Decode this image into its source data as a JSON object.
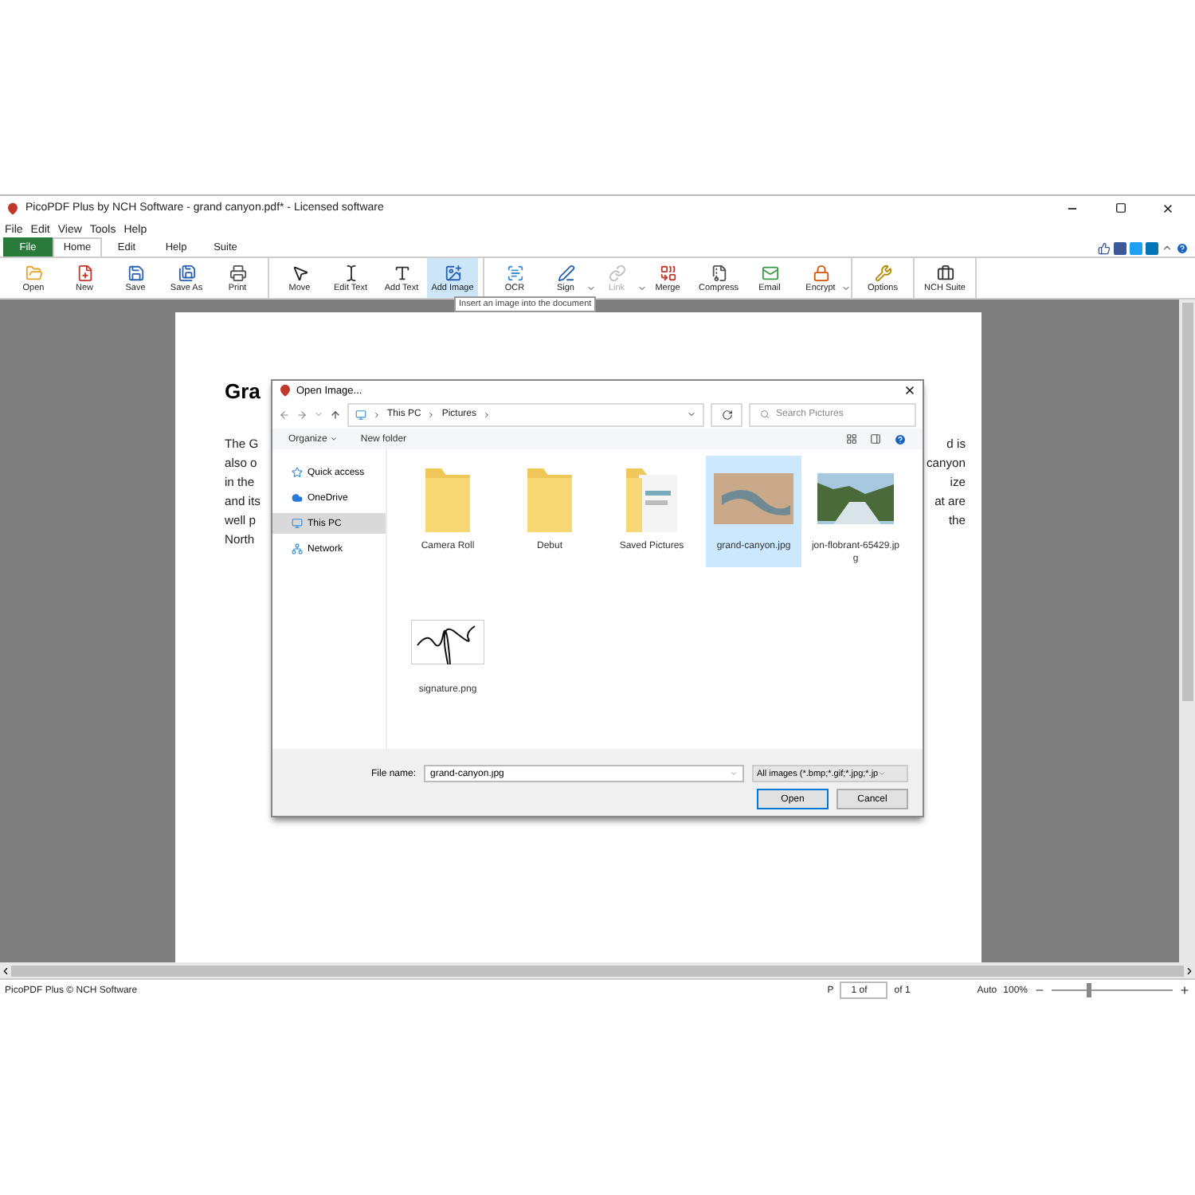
{
  "window": {
    "title": "PicoPDF Plus by NCH Software - grand canyon.pdf* - Licensed software"
  },
  "menu": [
    "File",
    "Edit",
    "View",
    "Tools",
    "Help"
  ],
  "ribbon_tabs": [
    {
      "label": "File",
      "kind": "file",
      "selected": false
    },
    {
      "label": "Home",
      "kind": "tab",
      "selected": true
    },
    {
      "label": "Edit",
      "kind": "tab",
      "selected": false
    },
    {
      "label": "Help",
      "kind": "tab",
      "selected": false
    },
    {
      "label": "Suite",
      "kind": "tab",
      "selected": false
    }
  ],
  "toolbar": [
    [
      {
        "label": "Open",
        "highlighted": false,
        "disabled": false,
        "dropdown": false
      },
      {
        "label": "New",
        "highlighted": false,
        "disabled": false,
        "dropdown": false
      },
      {
        "label": "Save",
        "highlighted": false,
        "disabled": false,
        "dropdown": false
      },
      {
        "label": "Save As",
        "highlighted": false,
        "disabled": false,
        "dropdown": false
      },
      {
        "label": "Print",
        "highlighted": false,
        "disabled": false,
        "dropdown": false
      }
    ],
    [
      {
        "label": "Move",
        "highlighted": false,
        "disabled": false,
        "dropdown": false
      },
      {
        "label": "Edit Text",
        "highlighted": false,
        "disabled": false,
        "dropdown": false
      },
      {
        "label": "Add Text",
        "highlighted": false,
        "disabled": false,
        "dropdown": false
      },
      {
        "label": "Add Image",
        "highlighted": true,
        "disabled": false,
        "dropdown": false
      }
    ],
    [
      {
        "label": "OCR",
        "highlighted": false,
        "disabled": false,
        "dropdown": false
      },
      {
        "label": "Sign",
        "highlighted": false,
        "disabled": false,
        "dropdown": true
      },
      {
        "label": "Link",
        "highlighted": false,
        "disabled": true,
        "dropdown": true
      },
      {
        "label": "Merge",
        "highlighted": false,
        "disabled": false,
        "dropdown": false
      },
      {
        "label": "Compress",
        "highlighted": false,
        "disabled": false,
        "dropdown": false
      },
      {
        "label": "Email",
        "highlighted": false,
        "disabled": false,
        "dropdown": false
      },
      {
        "label": "Encrypt",
        "highlighted": false,
        "disabled": false,
        "dropdown": true
      }
    ],
    [
      {
        "label": "Options",
        "highlighted": false,
        "disabled": false,
        "dropdown": false
      }
    ],
    [
      {
        "label": "NCH Suite",
        "highlighted": false,
        "disabled": false,
        "dropdown": false
      }
    ]
  ],
  "tooltip": "Insert an image into the document",
  "document": {
    "title": "Gra",
    "lines": [
      {
        "left": "The G",
        "right": "d is"
      },
      {
        "left": "also o",
        "right": "canyon"
      },
      {
        "left": "in the",
        "right": "ize"
      },
      {
        "left": "and its",
        "right": "at are"
      },
      {
        "left": "well p",
        "right": "the"
      },
      {
        "left": "North"
      }
    ]
  },
  "dialog": {
    "title": "Open Image...",
    "path": [
      "This PC",
      "Pictures"
    ],
    "search": {
      "placeholder": "Search Pictures"
    },
    "toolbar": [
      "Organize",
      "New folder"
    ],
    "nav": [
      {
        "label": "Quick access",
        "kind": "star",
        "selected": false
      },
      {
        "label": "OneDrive",
        "kind": "cloud",
        "selected": false
      },
      {
        "label": "This PC",
        "kind": "pc",
        "selected": true
      },
      {
        "label": "Network",
        "kind": "network",
        "selected": false
      }
    ],
    "files": [
      {
        "name": "Camera Roll",
        "kind": "folder",
        "selected": false
      },
      {
        "name": "Debut",
        "kind": "folder",
        "selected": false
      },
      {
        "name": "Saved Pictures",
        "kind": "folder-doc",
        "selected": false
      },
      {
        "name": "grand-canyon.jpg",
        "kind": "canyon",
        "selected": true
      },
      {
        "name": "jon-flobrant-65429.jpg",
        "kind": "river",
        "selected": false
      },
      {
        "name": "signature.png",
        "kind": "signature",
        "selected": false
      }
    ],
    "file_name_label": "File name:",
    "file_name": "grand-canyon.jpg",
    "filter": "All images (*.bmp;*.gif;*.jpg;*.jp",
    "buttons": [
      "Open",
      "Cancel"
    ]
  },
  "status_bar": {
    "text": "PicoPDF Plus © NCH Software",
    "page_label": "P",
    "page_input": "1 of",
    "page_total": "of 1",
    "zoom_mode": "Auto",
    "zoom": "100%",
    "zoom_slider": {
      "level": 0.3
    }
  }
}
